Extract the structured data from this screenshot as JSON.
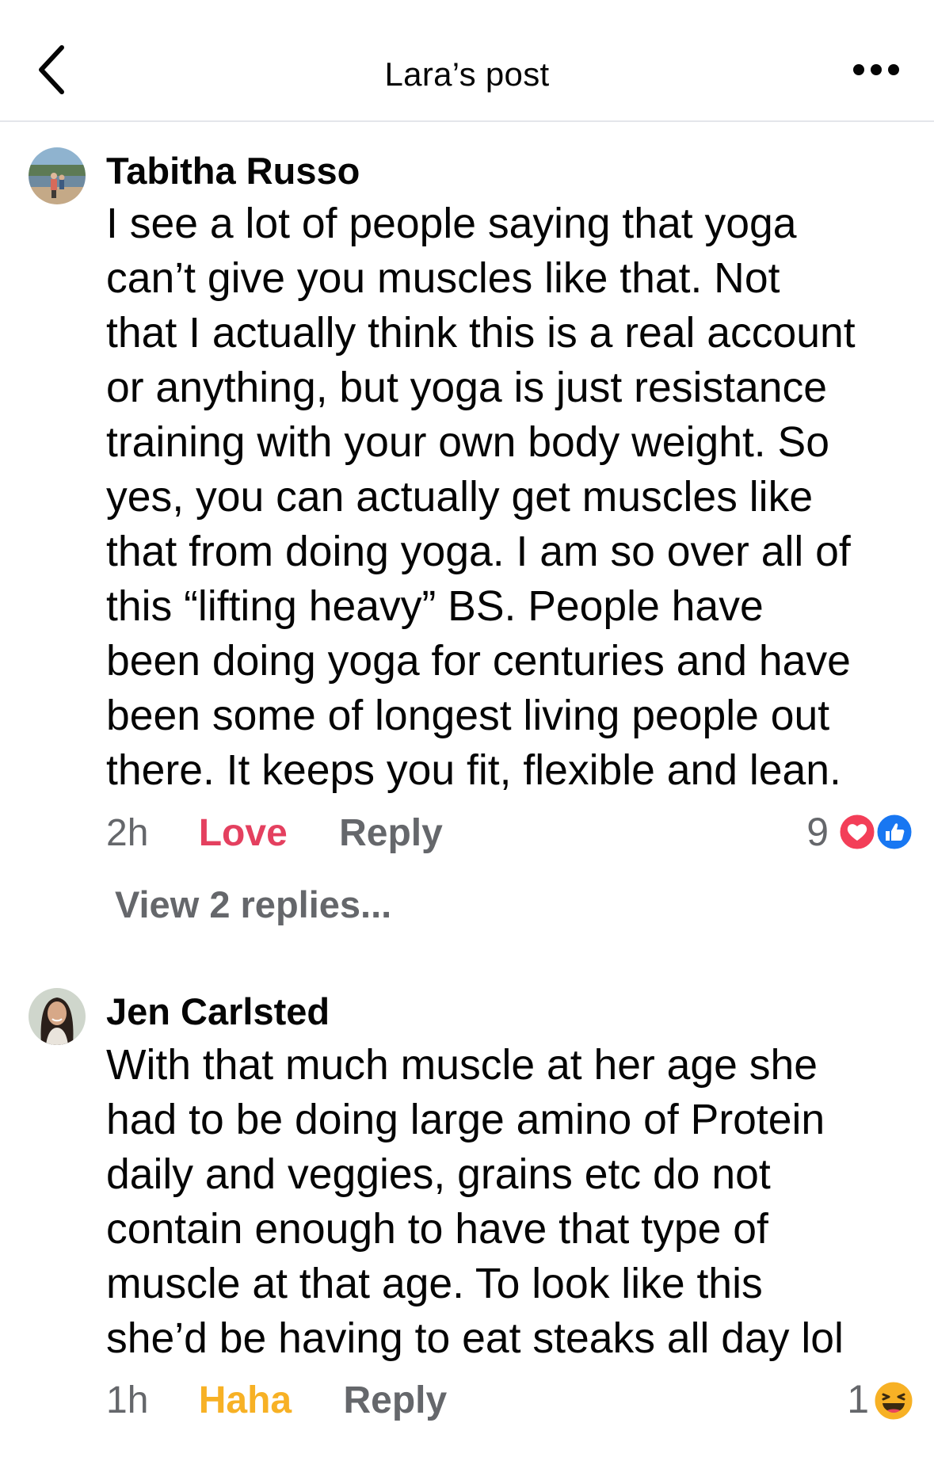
{
  "header": {
    "title": "Lara’s post"
  },
  "comments": [
    {
      "author": "Tabitha Russo",
      "text": "I see a lot of people saying that yoga\ncan’t give you muscles like that. Not\nthat I actually think this is a real account\nor anything, but yoga is just resistance\ntraining with your own body weight. So\nyes, you can actually get muscles like\nthat from doing yoga. I am so over all of\nthis “lifting heavy” BS. People have\nbeen doing yoga for centuries and have\nbeen some of longest living people out\nthere. It keeps you fit, flexible and lean.",
      "time": "2h",
      "reaction_label": "Love",
      "reply_label": "Reply",
      "reaction_count": "9",
      "reaction_icons": [
        "love-icon",
        "like-icon"
      ],
      "view_replies": "View 2 replies..."
    },
    {
      "author": "Jen Carlsted",
      "text": "With that much muscle at her age she\nhad to be doing large amino of Protein\ndaily and veggies, grains etc do not\ncontain enough to have that type of\nmuscle at that age.  To look like this\nshe’d be having to eat steaks all day lol",
      "time": "1h",
      "reaction_label": "Haha",
      "reply_label": "Reply",
      "reaction_count": "1",
      "reaction_icons": [
        "haha-icon"
      ]
    }
  ],
  "colors": {
    "love": "#e4405f",
    "haha": "#f7b125",
    "like": "#1877f2",
    "secondary_text": "#65676b"
  }
}
